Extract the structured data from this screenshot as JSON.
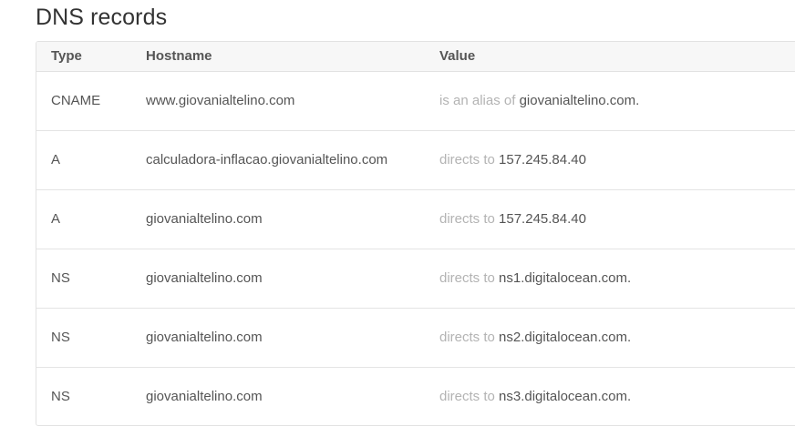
{
  "section": {
    "title": "DNS records"
  },
  "table": {
    "columns": {
      "type": "Type",
      "hostname": "Hostname",
      "value": "Value"
    },
    "rows": [
      {
        "type": "CNAME",
        "hostname": "www.giovanialtelino.com",
        "prefix": "is an alias of",
        "target": "giovanialtelino.com."
      },
      {
        "type": "A",
        "hostname": "calculadora-inflacao.giovanialtelino.com",
        "prefix": "directs to",
        "target": "157.245.84.40"
      },
      {
        "type": "A",
        "hostname": "giovanialtelino.com",
        "prefix": "directs to",
        "target": "157.245.84.40"
      },
      {
        "type": "NS",
        "hostname": "giovanialtelino.com",
        "prefix": "directs to",
        "target": "ns1.digitalocean.com."
      },
      {
        "type": "NS",
        "hostname": "giovanialtelino.com",
        "prefix": "directs to",
        "target": "ns2.digitalocean.com."
      },
      {
        "type": "NS",
        "hostname": "giovanialtelino.com",
        "prefix": "directs to",
        "target": "ns3.digitalocean.com."
      }
    ]
  }
}
